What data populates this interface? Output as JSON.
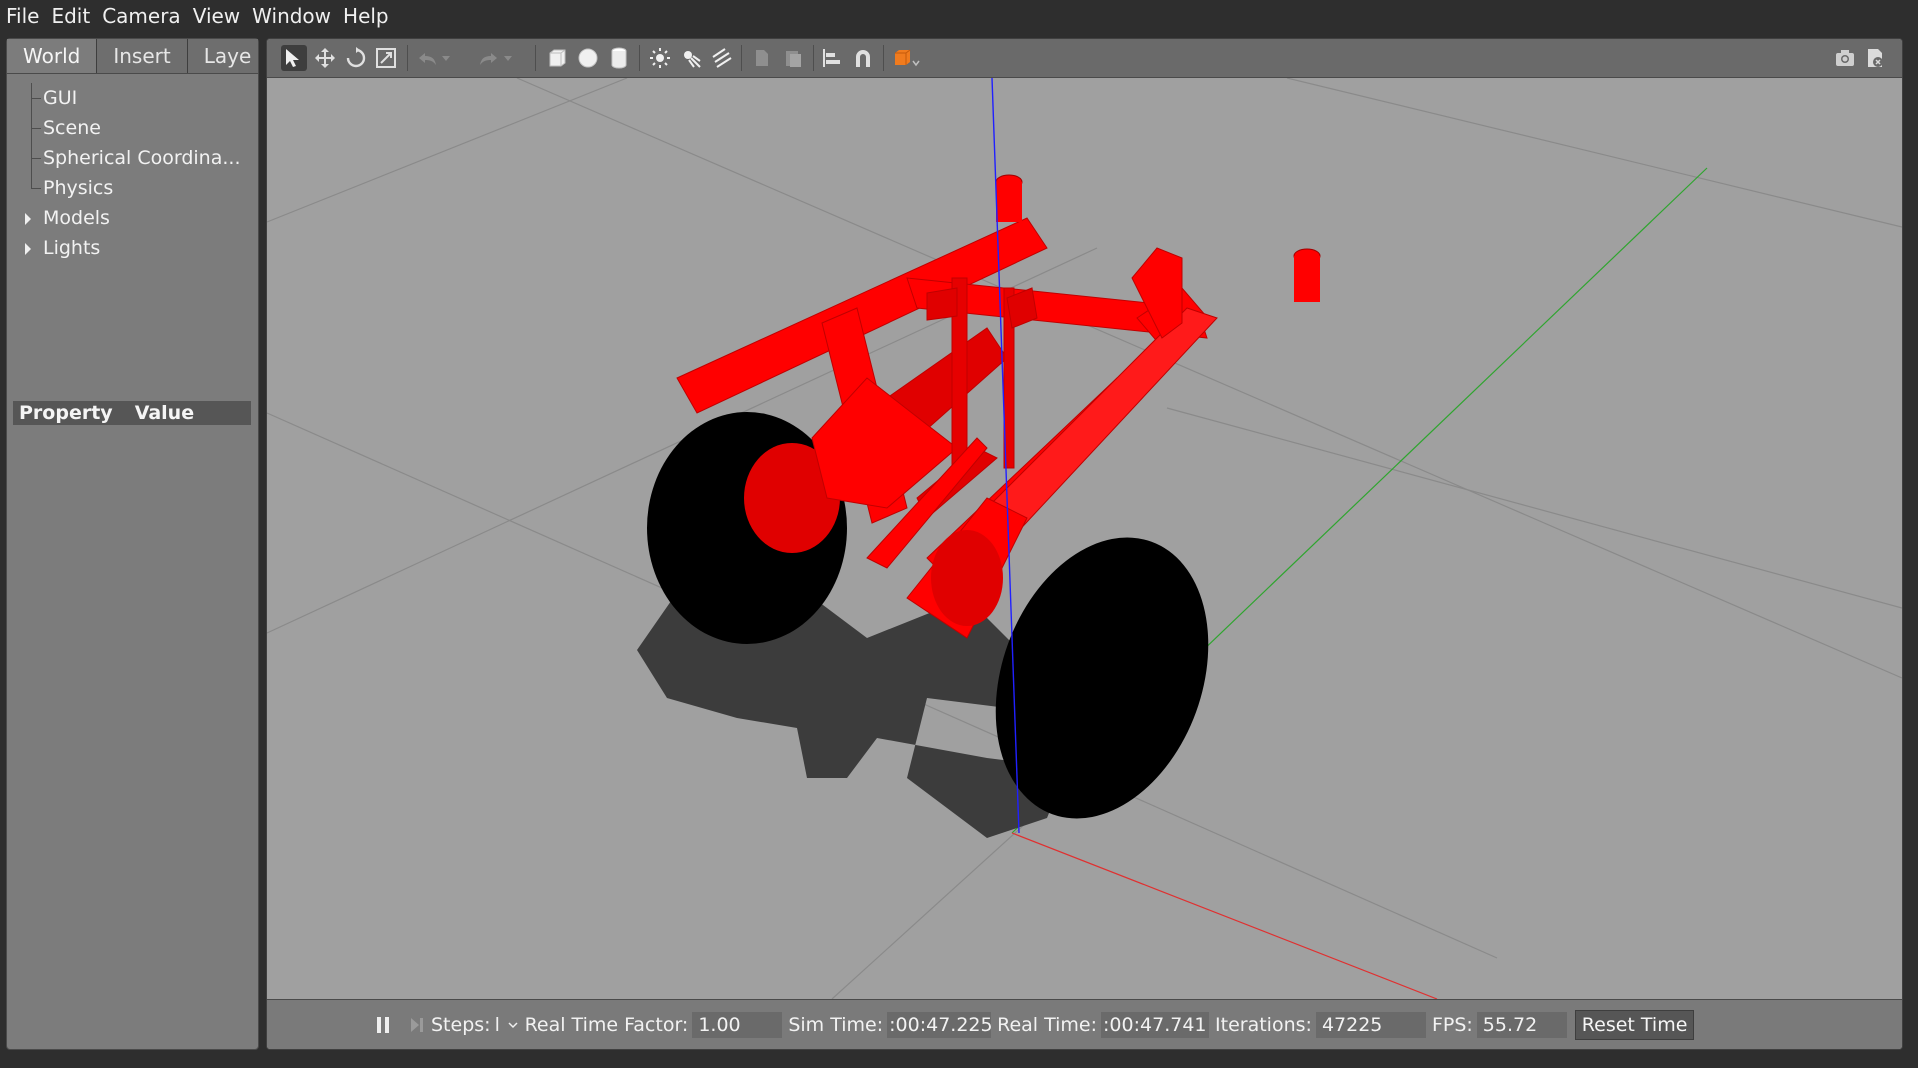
{
  "menubar": {
    "items": [
      "File",
      "Edit",
      "Camera",
      "View",
      "Window",
      "Help"
    ]
  },
  "left_panel": {
    "tabs": [
      "World",
      "Insert",
      "Laye"
    ],
    "active_tab": "World",
    "tree": [
      {
        "label": "GUI",
        "expandable": false
      },
      {
        "label": "Scene",
        "expandable": false
      },
      {
        "label": "Spherical Coordina...",
        "expandable": false
      },
      {
        "label": "Physics",
        "expandable": false
      },
      {
        "label": "Models",
        "expandable": true
      },
      {
        "label": "Lights",
        "expandable": true
      }
    ],
    "property_header": {
      "property": "Property",
      "value": "Value"
    }
  },
  "toolbar": {
    "tools": [
      "select-mode-icon",
      "translate-mode-icon",
      "rotate-mode-icon",
      "scale-mode-icon",
      "undo-icon",
      "undo-history-icon",
      "redo-icon",
      "redo-history-icon",
      "box-shape-icon",
      "sphere-shape-icon",
      "cylinder-shape-icon",
      "point-light-icon",
      "spot-light-icon",
      "directional-light-icon",
      "copy-icon",
      "paste-icon",
      "align-icon",
      "snap-icon",
      "view-angle-icon",
      "screenshot-icon",
      "record-log-icon"
    ],
    "colors": {
      "accent_orange": "#f07b1e"
    }
  },
  "scene": {
    "robot_color": "#ff0000",
    "wheel_color": "#000000",
    "ground_color": "#a0a0a0",
    "axis_colors": {
      "x": "#ff2222",
      "y": "#22cc22",
      "z": "#2222ff"
    }
  },
  "statusbar": {
    "steps_label": "Steps:",
    "steps_value": "l",
    "rtf_label": "Real Time Factor:",
    "rtf_value": "1.00",
    "sim_time_label": "Sim Time:",
    "sim_time_value": ":00:47.225",
    "real_time_label": "Real Time:",
    "real_time_value": ":00:47.741",
    "iterations_label": "Iterations:",
    "iterations_value": "47225",
    "fps_label": "FPS:",
    "fps_value": "55.72",
    "reset_label": "Reset Time"
  }
}
